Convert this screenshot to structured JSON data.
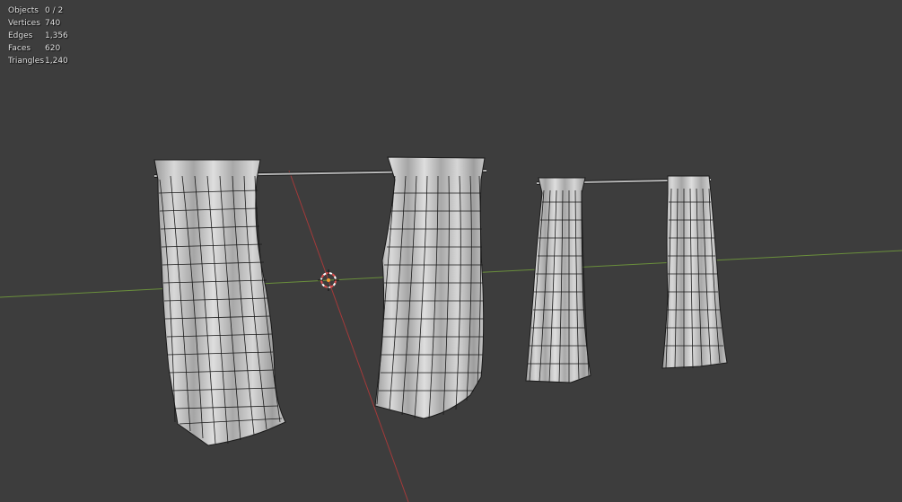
{
  "stats": {
    "rows": [
      {
        "label": "Objects",
        "value": "0 / 2"
      },
      {
        "label": "Vertices",
        "value": "740"
      },
      {
        "label": "Edges",
        "value": "1,356"
      },
      {
        "label": "Faces",
        "value": "620"
      },
      {
        "label": "Triangles",
        "value": "1,240"
      }
    ]
  },
  "colors": {
    "background": "#3d3d3d",
    "x_axis": "#a33a3a",
    "y_axis": "#6a8f3c",
    "cloth_fill": "#cdcdcd",
    "cloth_shade": "#9a9a9a",
    "wire": "#1a1a1a",
    "rod": "#b5b5b5",
    "cursor_red": "#e05050",
    "cursor_white": "#ffffff",
    "origin": "#f0a030"
  },
  "icons": {
    "cursor": "3d-cursor-icon",
    "origin": "object-origin-icon"
  }
}
